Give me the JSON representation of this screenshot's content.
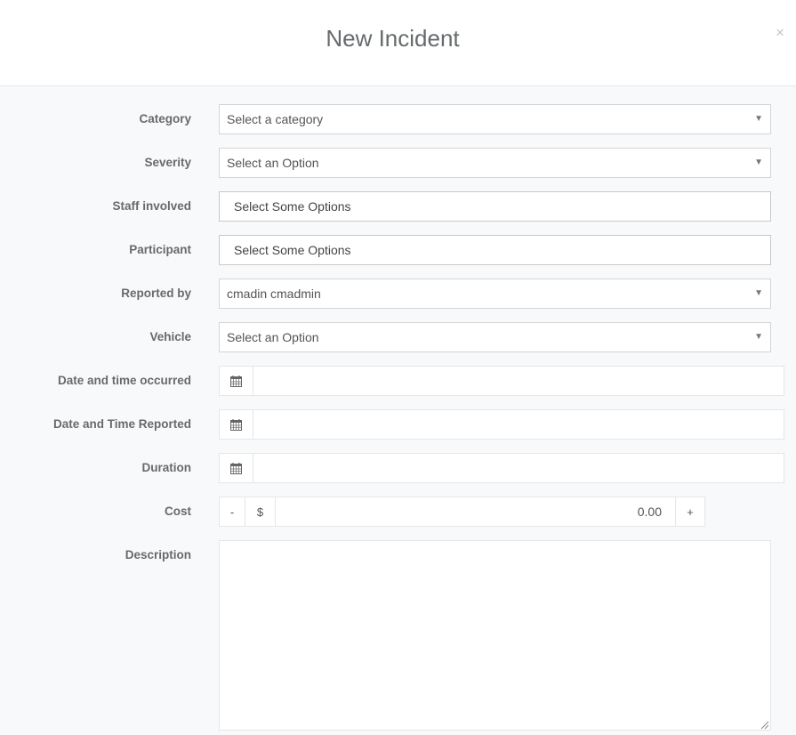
{
  "modal": {
    "title": "New Incident",
    "close_label": "×"
  },
  "form": {
    "category": {
      "label": "Category",
      "value": "Select a category"
    },
    "severity": {
      "label": "Severity",
      "value": "Select an Option"
    },
    "staff_involved": {
      "label": "Staff involved",
      "placeholder": "Select Some Options"
    },
    "participant": {
      "label": "Participant",
      "placeholder": "Select Some Options"
    },
    "reported_by": {
      "label": "Reported by",
      "value": "cmadin cmadmin"
    },
    "vehicle": {
      "label": "Vehicle",
      "value": "Select an Option"
    },
    "date_occurred": {
      "label": "Date and time occurred",
      "value": "",
      "icon": "calendar-icon"
    },
    "date_reported": {
      "label": "Date and Time Reported",
      "value": "",
      "icon": "calendar-icon"
    },
    "duration": {
      "label": "Duration",
      "value": "",
      "icon": "calendar-icon"
    },
    "cost": {
      "label": "Cost",
      "minus": "-",
      "currency": "$",
      "value": "0.00",
      "plus": "+"
    },
    "description": {
      "label": "Description",
      "value": ""
    }
  },
  "colors": {
    "background": "#f8f9fb",
    "header": "#ffffff",
    "label": "#676a6c",
    "border": "#e5e6e7"
  }
}
